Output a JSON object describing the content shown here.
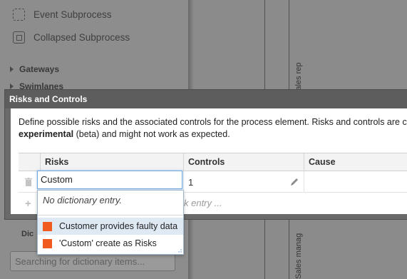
{
  "sidebar": {
    "items": [
      {
        "label": "Event Subprocess",
        "icon": "event-subprocess-icon"
      },
      {
        "label": "Collapsed Subprocess",
        "icon": "collapsed-subprocess-icon"
      }
    ],
    "groups": [
      {
        "label": "Gateways"
      },
      {
        "label": "Swimlanes"
      }
    ],
    "dictionary_label": "Dic",
    "dictionary_search_placeholder": "Searching for dictionary items..."
  },
  "canvas": {
    "lanes": [
      "Sales rep",
      "Sales manag"
    ]
  },
  "modal": {
    "title": "Risks and Controls",
    "description_line1": "Define possible risks and the associated controls for the process element. Risks and controls are c",
    "description_bold": "experimental",
    "description_rest": " (beta) and might not work as expected.",
    "columns": [
      "Risks",
      "Controls",
      "Cause"
    ],
    "row": {
      "risk_value": "Custom",
      "controls": "1",
      "cause": ""
    },
    "add_placeholder": "k entry ..."
  },
  "autocomplete": {
    "empty_text": "No dictionary entry.",
    "items": [
      {
        "label": "Customer provides faulty data",
        "color": "#f15a1e",
        "highlighted": true
      },
      {
        "label": "'Custom' create as Risks",
        "color": "#f15a1e",
        "highlighted": false
      }
    ]
  }
}
